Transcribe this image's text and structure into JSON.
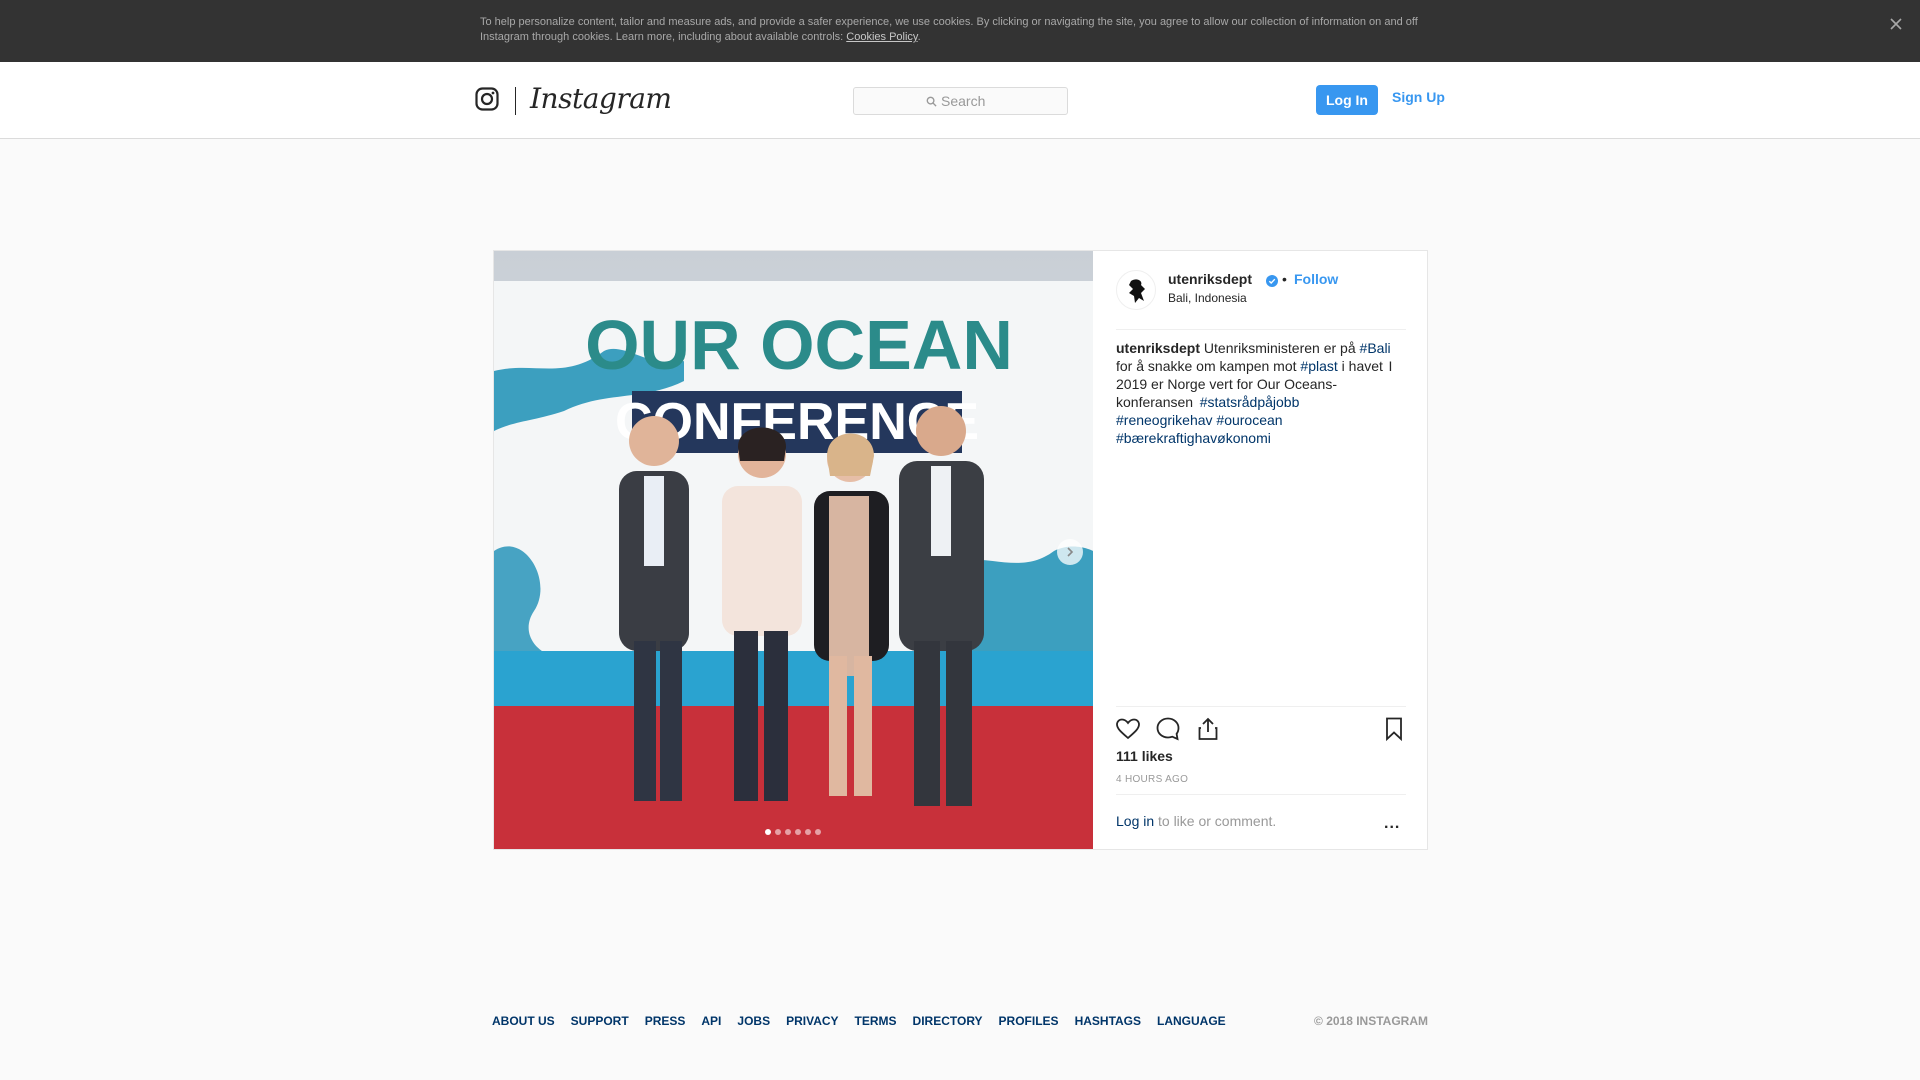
{
  "cookie_banner": {
    "text": "To help personalize content, tailor and measure ads, and provide a safer experience, we use cookies. By clicking or navigating the site, you agree to allow our collection of information on and off Instagram through cookies. Learn more, including about available controls: ",
    "link_label": "Cookies Policy",
    "trailing": ".",
    "close_icon": "close-icon"
  },
  "nav": {
    "logo_text": "Instagram",
    "search_placeholder": "Search",
    "login_label": "Log In",
    "signup_label": "Sign Up"
  },
  "post": {
    "username": "utenriksdept",
    "verified": true,
    "bullet": "•",
    "follow_label": "Follow",
    "location": "Bali, Indonesia",
    "caption": {
      "author": "utenriksdept",
      "text1": " Utenriksministeren er på ",
      "tag1": "#Bali",
      "text2": " for å snakke om kampen mot ",
      "tag2": "#plast",
      "text3": " i havet  I 2019 er Norge vert for Our Oceans-konferansen  ",
      "tag3": "#statsrådpåjobb",
      "tag4": "#reneogrikehav",
      "tag5": "#ourocean",
      "tag6": "#bærekraftighavøkonomi"
    },
    "photo": {
      "banner_line1": "OUR OCEAN",
      "banner_line2": "CONFERENCE",
      "slide_count": 6,
      "active_slide": 1
    },
    "likes": "111 likes",
    "time": "4 HOURS AGO",
    "comment_login": "Log in",
    "comment_rest": " to like or comment.",
    "more_label": "..."
  },
  "footer": {
    "links": [
      "ABOUT US",
      "SUPPORT",
      "PRESS",
      "API",
      "JOBS",
      "PRIVACY",
      "TERMS",
      "DIRECTORY",
      "PROFILES",
      "HASHTAGS",
      "LANGUAGE"
    ],
    "copyright": "© 2018 INSTAGRAM"
  },
  "colors": {
    "accent": "#3897f0",
    "link": "#003569",
    "banner_bg": "#333333"
  }
}
